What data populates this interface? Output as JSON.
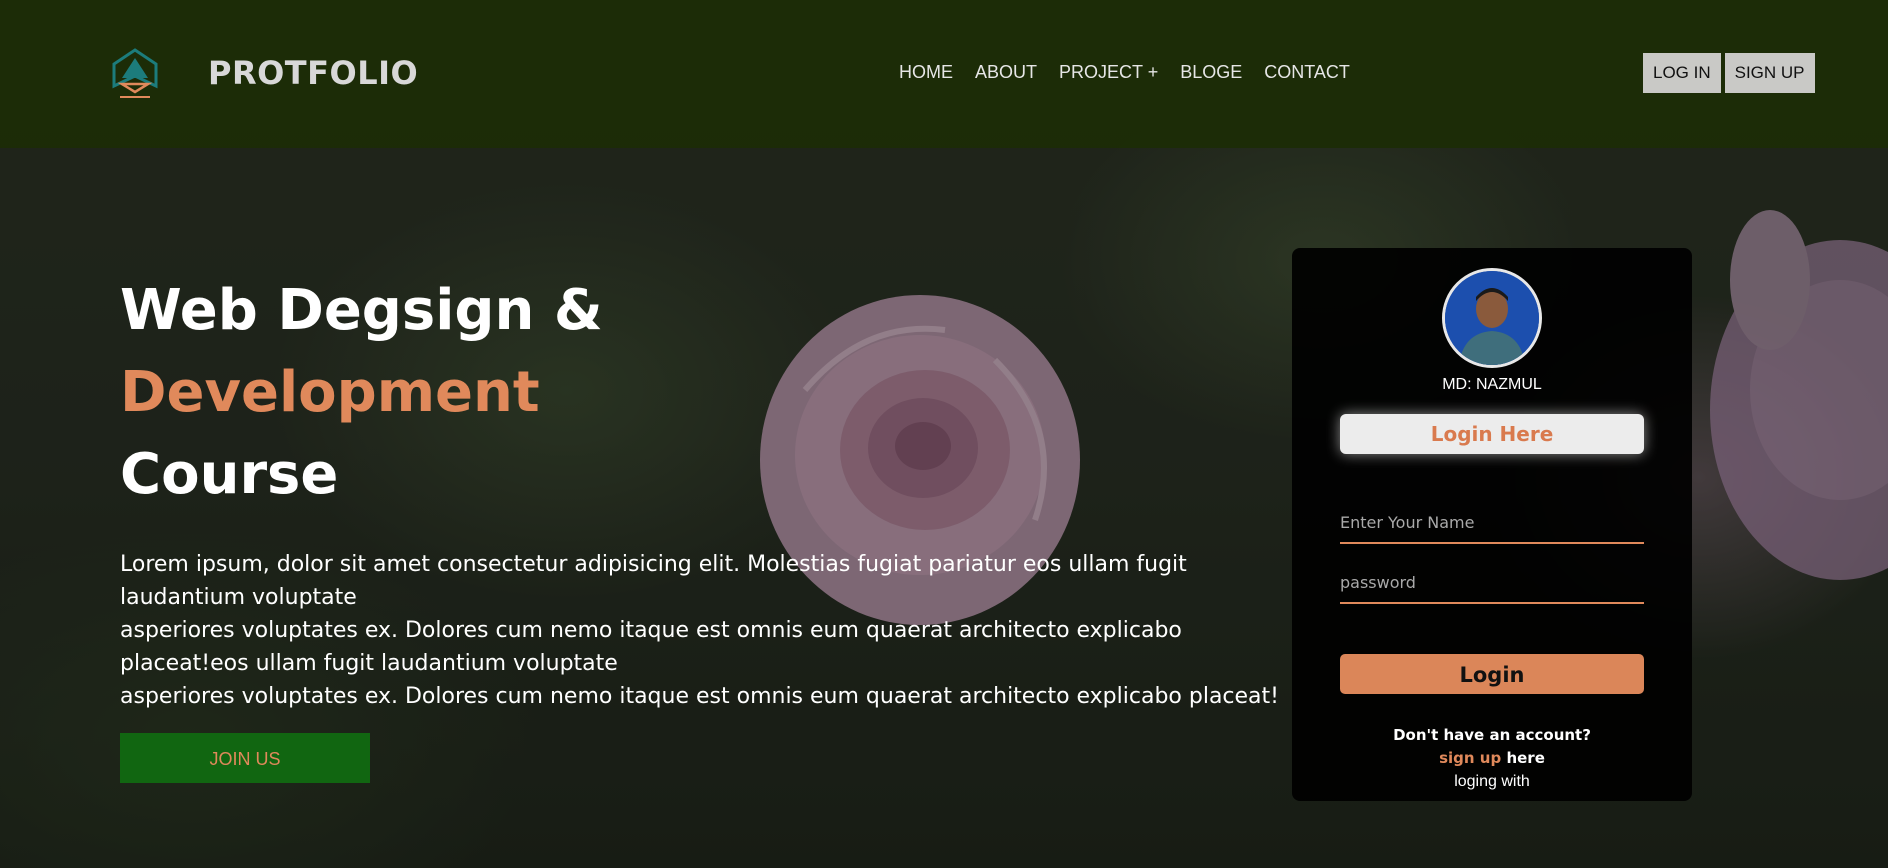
{
  "header": {
    "brand": "PROTFOLIO",
    "nav": [
      "HOME",
      "ABOUT",
      "PROJECT +",
      "BLOGE",
      "CONTACT"
    ],
    "login_label": "LOG IN",
    "signup_label": "SIGN UP"
  },
  "hero": {
    "title_line1": "Web Degsign &",
    "title_line2": "Development",
    "title_line3": "Course",
    "description_lines": [
      "Lorem ipsum, dolor sit amet consectetur adipisicing elit. Molestias fugiat pariatur eos ullam fugit laudantium voluptate",
      "asperiores voluptates ex. Dolores cum nemo itaque est omnis eum quaerat architecto explicabo placeat!eos ullam fugit laudantium voluptate",
      "asperiores voluptates ex. Dolores cum nemo itaque est omnis eum quaerat architecto explicabo placeat!"
    ],
    "join_label": "JOIN US"
  },
  "login_card": {
    "user_name": "MD: NAZMUL",
    "heading": "Login Here",
    "name_placeholder": "Enter Your Name",
    "password_placeholder": "password",
    "login_label": "Login",
    "no_account": "Don't have an account?",
    "signup_link": "sign up",
    "signup_suffix": "here",
    "loging_with": "loging with"
  },
  "colors": {
    "accent": "#e0895b",
    "header_bg": "#1c2d05",
    "join_bg": "#116611"
  }
}
